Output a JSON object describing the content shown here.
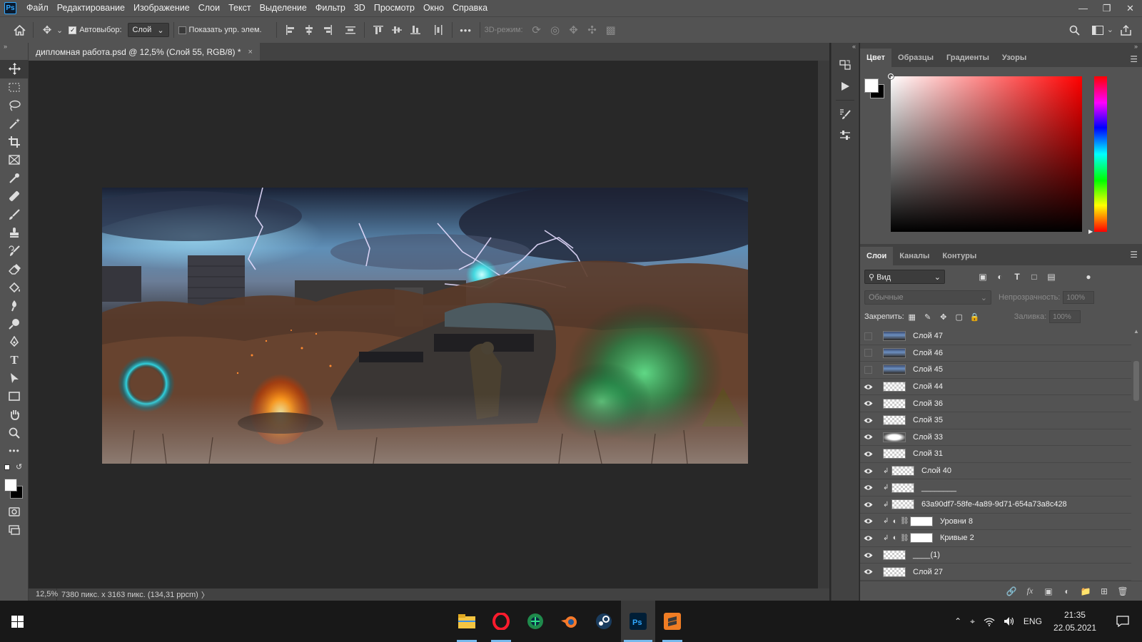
{
  "app": {
    "logo": "Ps",
    "menu": [
      "Файл",
      "Редактирование",
      "Изображение",
      "Слои",
      "Текст",
      "Выделение",
      "Фильтр",
      "3D",
      "Просмотр",
      "Окно",
      "Справка"
    ]
  },
  "window_controls": [
    "minimize-icon",
    "restore-icon",
    "close-icon"
  ],
  "options_bar": {
    "autoselect_label": "Автовыбор:",
    "autoselect_checked": true,
    "autoselect_target": "Слой",
    "show_transform_label": "Показать упр. элем.",
    "show_transform_checked": false,
    "mode_3d_label": "3D-режим:",
    "more_label": "•••"
  },
  "document": {
    "tab_title": "дипломная работа.psd @ 12,5% (Слой 55, RGB/8) *",
    "tab_close": "×"
  },
  "status": {
    "zoom": "12,5%",
    "info": "7380 пикс. x 3163 пикс. (134,31 ppcm)",
    "arrow": "〉"
  },
  "color_panel": {
    "tabs": [
      "Цвет",
      "Образцы",
      "Градиенты",
      "Узоры"
    ],
    "active_tab": "Цвет",
    "foreground": "#ffffff",
    "background": "#000000",
    "hue": "#ff0000"
  },
  "layers_panel": {
    "tabs": [
      "Слои",
      "Каналы",
      "Контуры"
    ],
    "active_tab": "Слои",
    "kind_filter": "Вид",
    "blend_mode": "Обычные",
    "opacity_label": "Непрозрачность:",
    "opacity_value": "100%",
    "lock_label": "Закрепить:",
    "fill_label": "Заливка:",
    "fill_value": "100%",
    "layers": [
      {
        "name": "Слой 47",
        "visible": false,
        "thumb": "photo",
        "clipped": false,
        "adjustment": false
      },
      {
        "name": "Слой 46",
        "visible": false,
        "thumb": "photo",
        "clipped": false,
        "adjustment": false
      },
      {
        "name": "Слой 45",
        "visible": false,
        "thumb": "photo",
        "clipped": false,
        "adjustment": false
      },
      {
        "name": "Слой 44",
        "visible": true,
        "thumb": "transparent",
        "clipped": false,
        "adjustment": false
      },
      {
        "name": "Слой 36",
        "visible": true,
        "thumb": "transparent",
        "clipped": false,
        "adjustment": false
      },
      {
        "name": "Слой 35",
        "visible": true,
        "thumb": "transparent",
        "clipped": false,
        "adjustment": false
      },
      {
        "name": "Слой 33",
        "visible": true,
        "thumb": "oval",
        "clipped": false,
        "adjustment": false
      },
      {
        "name": "Слой 31",
        "visible": true,
        "thumb": "transparent",
        "clipped": false,
        "adjustment": false
      },
      {
        "name": "Слой 40",
        "visible": true,
        "thumb": "transparent",
        "clipped": true,
        "adjustment": false
      },
      {
        "name": "________",
        "visible": true,
        "thumb": "transparent",
        "clipped": true,
        "adjustment": false
      },
      {
        "name": "63a90df7-58fe-4a89-9d71-654a73a8c428",
        "visible": true,
        "thumb": "transparent",
        "clipped": true,
        "adjustment": false
      },
      {
        "name": "Уровни 8",
        "visible": true,
        "thumb": "white",
        "clipped": true,
        "adjustment": true
      },
      {
        "name": "Кривые 2",
        "visible": true,
        "thumb": "white",
        "clipped": true,
        "adjustment": true
      },
      {
        "name": "____(1)",
        "visible": true,
        "thumb": "transparent",
        "clipped": false,
        "adjustment": false
      },
      {
        "name": "Слой 27",
        "visible": true,
        "thumb": "transparent",
        "clipped": false,
        "adjustment": false
      }
    ]
  },
  "taskbar": {
    "apps": [
      "file-explorer-icon",
      "opera-icon",
      "browser-icon",
      "blender-icon",
      "steam-icon",
      "photoshop-icon",
      "sublime-icon"
    ],
    "language": "ENG",
    "time": "21:35",
    "date": "22.05.2021"
  }
}
